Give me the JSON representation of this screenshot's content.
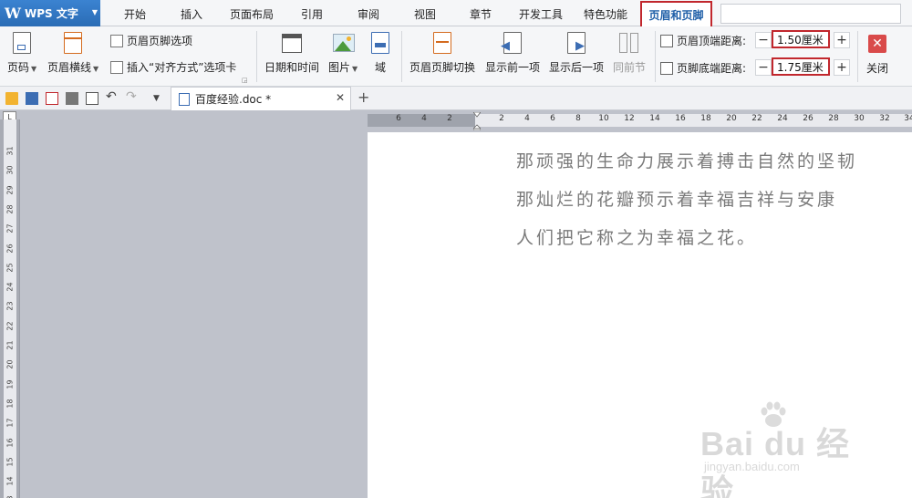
{
  "app": {
    "logo": "W",
    "name": "WPS 文字"
  },
  "menu_tabs": [
    "开始",
    "插入",
    "页面布局",
    "引用",
    "审阅",
    "视图",
    "章节",
    "开发工具",
    "特色功能"
  ],
  "active_tab": "页眉和页脚",
  "ribbon": {
    "page_number": "页码",
    "header_line": "页眉横线",
    "header_footer_options": "页眉页脚选项",
    "insert_align_tab": "插入“对齐方式”选项卡",
    "date_time": "日期和时间",
    "picture": "图片",
    "field": "域",
    "switch_header_footer": "页眉页脚切换",
    "show_previous": "显示前一项",
    "show_next": "显示后一项",
    "same_as_previous": "同前节",
    "header_top_distance_label": "页眉顶端距离:",
    "header_top_distance_value": "1.50厘米",
    "footer_bottom_distance_label": "页脚底端距离:",
    "footer_bottom_distance_value": "1.75厘米",
    "close": "关闭"
  },
  "doc_tab": {
    "name": "百度经验.doc *"
  },
  "ruler_h_ticks": [
    "6",
    "4",
    "2",
    "2",
    "4",
    "6",
    "8",
    "10",
    "12",
    "14",
    "16",
    "18",
    "20",
    "22",
    "24",
    "26",
    "28",
    "30",
    "32",
    "34"
  ],
  "ruler_v_ticks": [
    "31",
    "30",
    "29",
    "28",
    "27",
    "26",
    "25",
    "24",
    "23",
    "22",
    "21",
    "20",
    "19",
    "18",
    "17",
    "16",
    "15",
    "14",
    "13"
  ],
  "document": {
    "lines": [
      "那顽强的生命力展示着搏击自然的坚韧",
      "那灿烂的花瓣预示着幸福吉祥与安康",
      "人们把它称之为幸福之花。"
    ]
  },
  "watermark": {
    "text": "Bai du 经验",
    "url": "jingyan.baidu.com"
  }
}
